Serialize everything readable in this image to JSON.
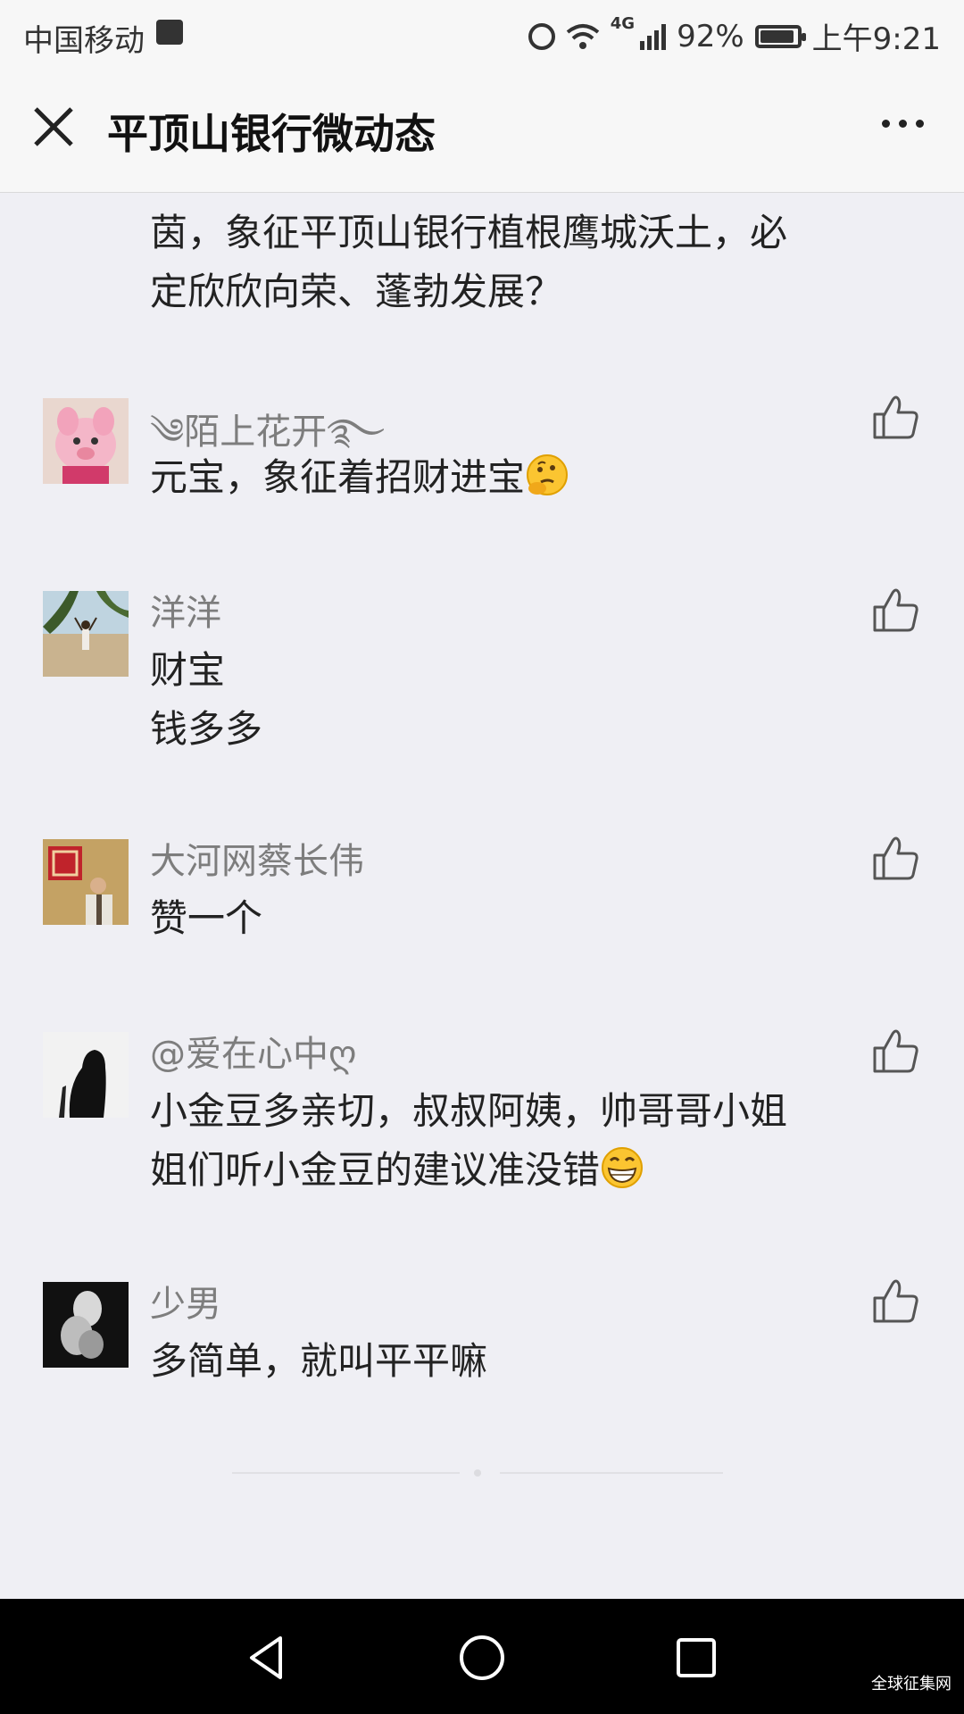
{
  "status_bar": {
    "carrier": "中国移动",
    "network": "4G",
    "battery": "92%",
    "battery_level": 0.92,
    "time": "上午9:21"
  },
  "nav": {
    "title": "平顶山银行微动态",
    "close_icon": "close-icon",
    "more_icon": "more-icon"
  },
  "partial_comment": {
    "text_line1": "茵，象征平顶山银行植根鹰城沃土，必",
    "text_line2": "定欣欣向荣、蓬勃发展？"
  },
  "comments": [
    {
      "name": "༄陌上花开࿐",
      "text": "元宝，象征着招财进宝",
      "emoji": "thinking-face"
    },
    {
      "name": "洋洋",
      "text": "财宝",
      "text2": "钱多多"
    },
    {
      "name": "大河网蔡长伟",
      "text": "赞一个"
    },
    {
      "name": "@爱在心中ღ",
      "text": "小金豆多亲切，叔叔阿姨，帅哥哥小姐",
      "text2": "姐们听小金豆的建议准没错",
      "emoji": "grinning-face"
    },
    {
      "name": "少男",
      "text": "多简单，就叫平平嘛"
    }
  ],
  "watermark": "全球征集网",
  "colors": {
    "background": "#efeff4",
    "name": "#7d7d7d",
    "text": "#222222",
    "nav_bg": "#f7f7f7"
  }
}
